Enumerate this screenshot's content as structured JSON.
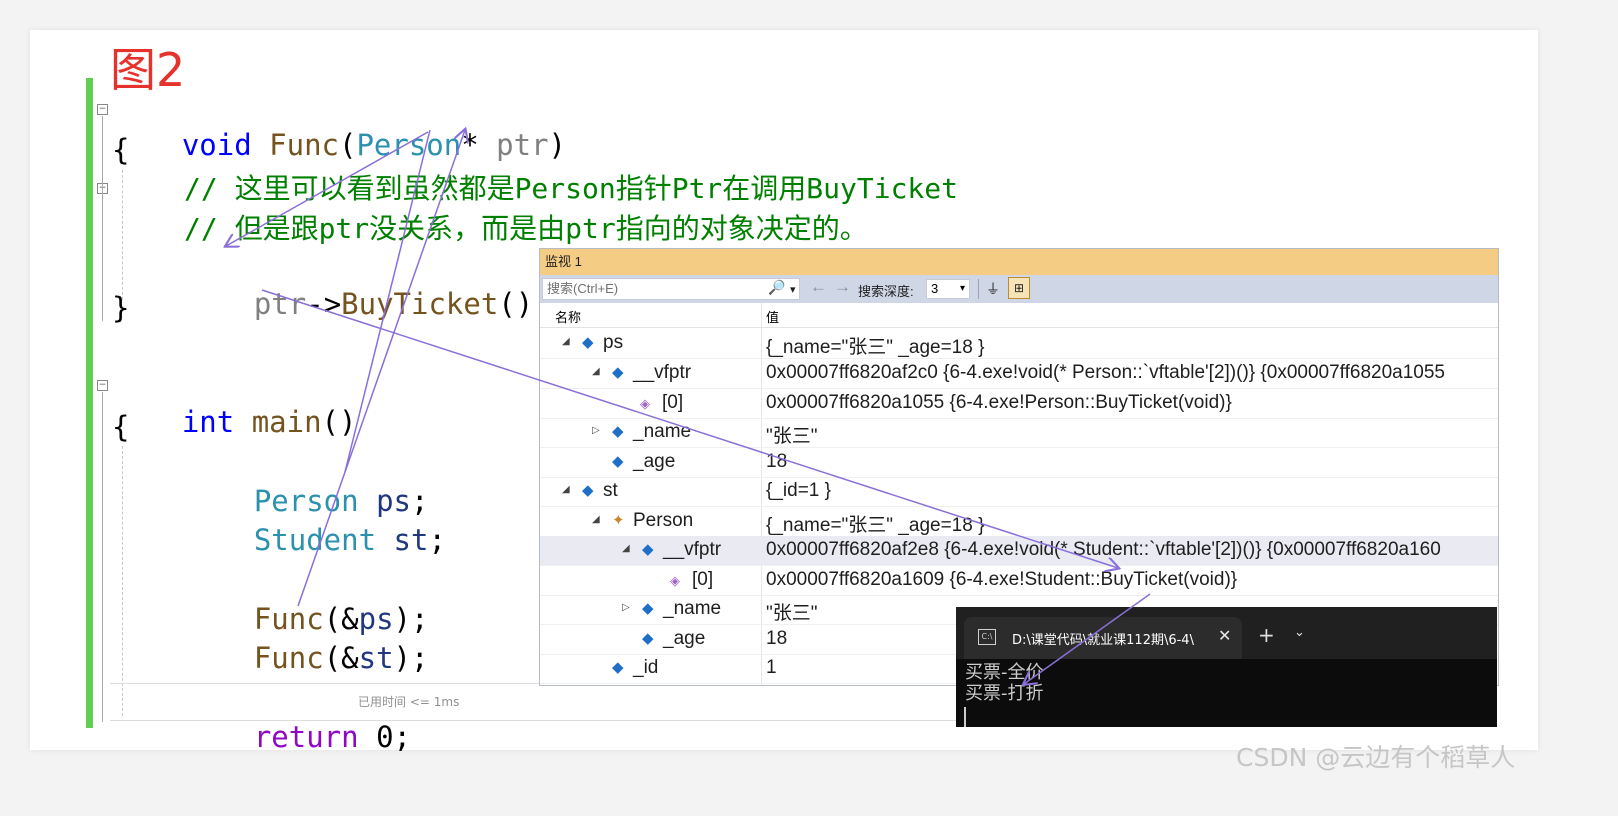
{
  "figure_label": "图2",
  "code": {
    "line1": {
      "kw": "void",
      "fn": "Func",
      "open": "(",
      "type": "Person",
      "star": "* ",
      "param": "ptr",
      "close": ")"
    },
    "brace_open1": "{",
    "comment1": "// 这里可以看到虽然都是Person指针Ptr在调用BuyTicket",
    "comment2": "// 但是跟ptr没关系，而是由ptr指向的对象决定的。",
    "call": {
      "var": "ptr",
      "arrow": "->",
      "fn": "BuyTicket",
      "rest": "();"
    },
    "brace_close1": "}",
    "main": {
      "kw": "int",
      "fn": "main",
      "rest": "()"
    },
    "brace_open2": "{",
    "decl1": {
      "type": "Person",
      "var": "ps",
      "end": ";"
    },
    "decl2": {
      "type": "Student",
      "var": "st",
      "end": ";"
    },
    "call1": {
      "fn": "Func",
      "open": "(&",
      "var": "ps",
      "end": ");"
    },
    "call2": {
      "fn": "Func",
      "open": "(&",
      "var": "st",
      "end": ");"
    },
    "ret": {
      "kw": "return",
      "num": "0",
      "end": ";"
    },
    "elapsed": "已用时间 <= 1ms"
  },
  "watch": {
    "title": "监视 1",
    "search_placeholder": "搜索(Ctrl+E)",
    "search_icon": "🔎",
    "search_drop": "▾",
    "nav_back": "←",
    "nav_fwd": "→",
    "depth_label": "搜索深度:",
    "depth_value": "3",
    "depth_drop": "▾",
    "col_name": "名称",
    "col_value": "值",
    "rows": [
      {
        "name": "ps",
        "value": "{_name=\"张三\" _age=18 }"
      },
      {
        "name": "__vfptr",
        "value": "0x00007ff6820af2c0 {6-4.exe!void(* Person::`vftable'[2])()} {0x00007ff6820a1055"
      },
      {
        "name": "[0]",
        "value": "0x00007ff6820a1055 {6-4.exe!Person::BuyTicket(void)}"
      },
      {
        "name": "_name",
        "value": "\"张三\""
      },
      {
        "name": "_age",
        "value": "18"
      },
      {
        "name": "st",
        "value": "{_id=1 }"
      },
      {
        "name": "Person",
        "value": "{_name=\"张三\" _age=18 }"
      },
      {
        "name": "__vfptr",
        "value": "0x00007ff6820af2e8 {6-4.exe!void(* Student::`vftable'[2])()} {0x00007ff6820a160"
      },
      {
        "name": "[0]",
        "value": "0x00007ff6820a1609 {6-4.exe!Student::BuyTicket(void)}"
      },
      {
        "name": "_name",
        "value": "\"张三\""
      },
      {
        "name": "_age",
        "value": "18"
      },
      {
        "name": "_id",
        "value": "1"
      }
    ]
  },
  "console": {
    "tab_title": "D:\\课堂代码\\就业课112期\\6-4\\",
    "tab_icon": "C:\\",
    "close": "✕",
    "plus": "+",
    "drop": "⌄",
    "line1": "买票-全价",
    "line2": "买票-打折"
  },
  "watermark": "CSDN @云边有个稻草人",
  "colors": {
    "arrow": "#8a6fd8",
    "accent_green": "#5fcf4f",
    "figure_red": "#e5322d",
    "watch_title": "#f5cc84"
  }
}
